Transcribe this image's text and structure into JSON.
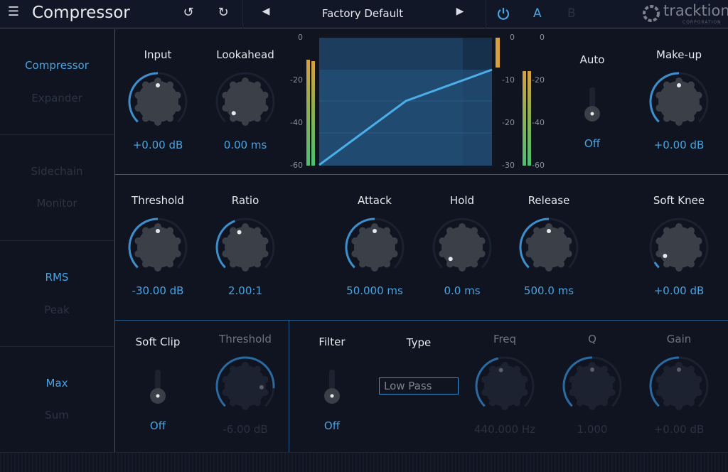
{
  "header": {
    "title": "Compressor",
    "preset": "Factory Default",
    "a_label": "A",
    "b_label": "B",
    "brand": "tracktion",
    "brand_sub": "CORPORATION",
    "icons": [
      "menu-icon",
      "undo-icon",
      "redo-icon",
      "prev-preset-icon",
      "next-preset-icon",
      "power-icon"
    ]
  },
  "sidebar": {
    "items": [
      {
        "label": "Compressor",
        "active": true
      },
      {
        "label": "Expander",
        "active": false
      },
      {
        "label": "Sidechain",
        "active": false
      },
      {
        "label": "Monitor",
        "active": false
      },
      {
        "label": "RMS",
        "active": true
      },
      {
        "label": "Peak",
        "active": false
      },
      {
        "label": "Max",
        "active": true
      },
      {
        "label": "Sum",
        "active": false
      }
    ]
  },
  "top": {
    "input": {
      "label": "Input",
      "value": "+0.00 dB",
      "level": 0.5
    },
    "lookahead": {
      "label": "Lookahead",
      "value": "0.00 ms",
      "level": 0
    },
    "auto": {
      "label": "Auto",
      "value": "Off"
    },
    "makeup": {
      "label": "Make-up",
      "value": "+0.00 dB",
      "level": 0.5
    }
  },
  "graph": {
    "left_ticks": [
      "0",
      "-20",
      "-40",
      "-60"
    ],
    "mid_ticks": [
      "0",
      "-10",
      "-20",
      "-30"
    ],
    "right_ticks": [
      "0",
      "-20",
      "-40",
      "-60"
    ]
  },
  "middle": {
    "threshold": {
      "label": "Threshold",
      "value": "-30.00 dB",
      "level": 0.5
    },
    "ratio": {
      "label": "Ratio",
      "value": "2.00:1",
      "level": 0.42
    },
    "attack": {
      "label": "Attack",
      "value": "50.000 ms",
      "level": 0.5
    },
    "hold": {
      "label": "Hold",
      "value": "0.0 ms",
      "level": 0
    },
    "release": {
      "label": "Release",
      "value": "500.0 ms",
      "level": 0.5
    },
    "softknee": {
      "label": "Soft Knee",
      "value": "+0.00 dB",
      "level": 0.05
    }
  },
  "bottom": {
    "softclip": {
      "label": "Soft Clip",
      "value": "Off"
    },
    "sc_threshold": {
      "label": "Threshold",
      "value": "-6.00 dB",
      "level": 0.85
    },
    "filter": {
      "label": "Filter",
      "value": "Off"
    },
    "type": {
      "label": "Type",
      "value": "Low Pass"
    },
    "freq": {
      "label": "Freq",
      "value": "440.000 Hz",
      "level": 0.45
    },
    "q": {
      "label": "Q",
      "value": "1.000",
      "level": 0.5
    },
    "gain": {
      "label": "Gain",
      "value": "+0.00 dB",
      "level": 0.5
    }
  },
  "colors": {
    "accent": "#4aa3e0",
    "background": "#0f1420",
    "divider": "#2a5a86",
    "meter_orange": "#d9a040"
  }
}
